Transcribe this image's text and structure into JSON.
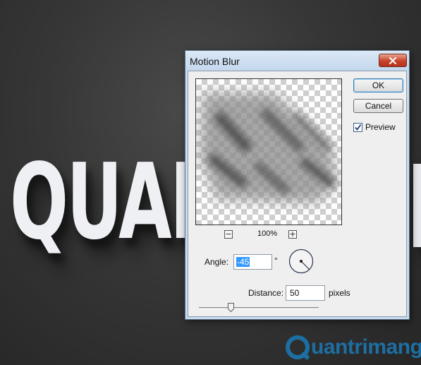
{
  "canvas": {
    "artwork_text": "QUAN",
    "watermark_text": "uantrimang"
  },
  "dialog": {
    "title": "Motion Blur",
    "ok_label": "OK",
    "cancel_label": "Cancel",
    "preview_label": "Preview",
    "preview_checked": true,
    "zoom_out_label": "−",
    "zoom_in_label": "+",
    "zoom_level": "100%",
    "angle_label": "Angle:",
    "angle_value": "-45",
    "angle_unit": "°",
    "distance_label": "Distance:",
    "distance_value": "50",
    "distance_unit": "pixels",
    "distance_slider_fraction": 0.27
  },
  "icons": {
    "close": "close-x-icon",
    "angle_dial": "angle-dial-icon",
    "checkmark": "checkmark-icon"
  },
  "colors": {
    "titlebar": "#c9dcf0",
    "close_button": "#c8432a",
    "selection": "#3399ff",
    "watermark": "#1d6fa3"
  }
}
